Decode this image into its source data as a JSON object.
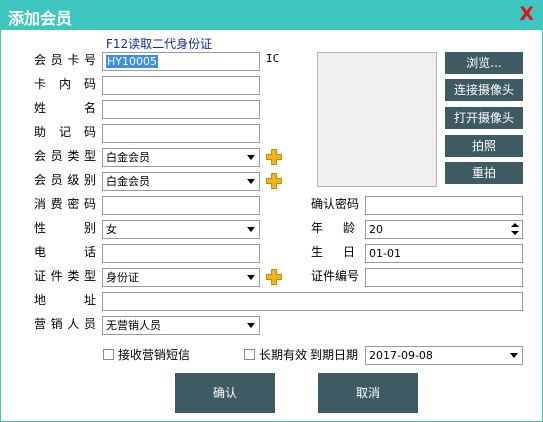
{
  "window": {
    "title": "添加会员",
    "close": "X"
  },
  "reader_hint": "F12读取二代身份证",
  "ic_label": "IC",
  "labels": {
    "card_no": "会员卡号",
    "inner_code": "卡内码",
    "name": "姓名",
    "mnemonic": "助记码",
    "member_type": "会员类型",
    "member_level": "会员级别",
    "pay_password": "消费密码",
    "gender": "性别",
    "phone": "电话",
    "id_type": "证件类型",
    "address": "地址",
    "sales": "营销人员",
    "confirm_password": "确认密码",
    "age": "年龄",
    "birthday": "生日",
    "id_number": "证件编号"
  },
  "values": {
    "card_no": "HY10005",
    "inner_code": "",
    "name": "",
    "mnemonic": "",
    "member_type": "白金会员",
    "member_level": "白金会员",
    "pay_password": "",
    "gender": "女",
    "phone": "",
    "id_type": "身份证",
    "address": "",
    "sales": "无营销人员",
    "confirm_password": "",
    "age": "20",
    "birthday": "01-01",
    "id_number": "",
    "expire_date": "2017-09-08"
  },
  "side_buttons": {
    "browse": "浏览...",
    "connect_camera": "连接摄像头",
    "open_camera": "打开摄像头",
    "capture": "拍照",
    "retake": "重拍"
  },
  "checkboxes": {
    "sms": "接收营销短信",
    "long_term": "长期有效",
    "expire_label": "到期日期"
  },
  "buttons": {
    "ok": "确认",
    "cancel": "取消"
  },
  "colors": {
    "titlebar": "#3ec7c0",
    "button": "#3e5a62",
    "close": "#e8101a",
    "plus": "#f2b31b"
  }
}
